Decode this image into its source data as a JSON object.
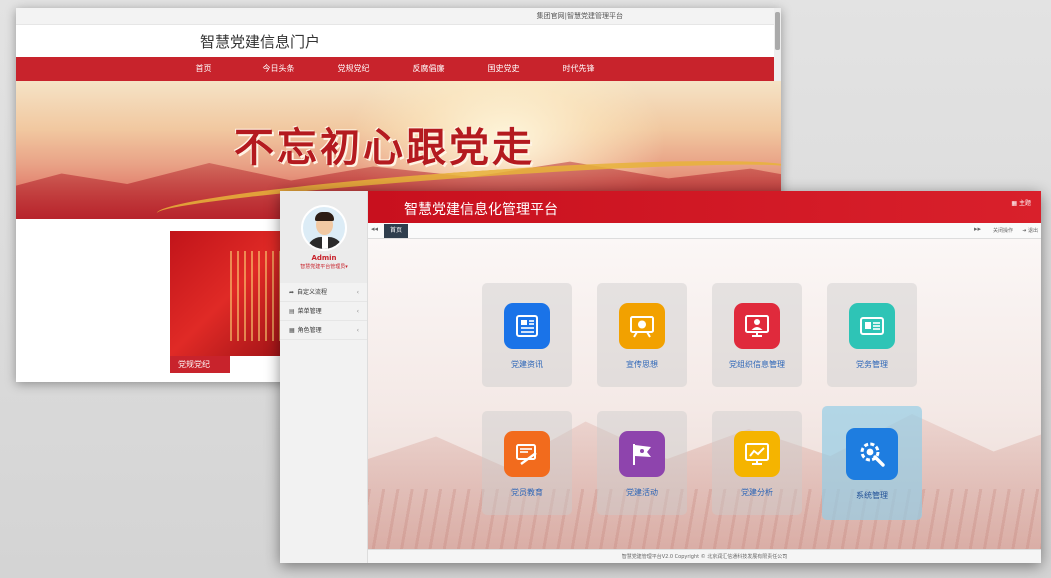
{
  "portal": {
    "topbar_link": "集团官网|智慧党建管理平台",
    "title": "智慧党建信息门户",
    "nav": [
      "首页",
      "今日头条",
      "党规党纪",
      "反腐倡廉",
      "国史党史",
      "时代先锋"
    ],
    "banner_slogan": "不忘初心跟党走",
    "news_caption": "党规党纪"
  },
  "platform": {
    "title": "智慧党建信息化管理平台",
    "topbar_home": "主题",
    "user_name": "Admin",
    "user_role": "智慧党建平台管理员",
    "menu": [
      {
        "label": "自定义流程",
        "icon": "➦"
      },
      {
        "label": "菜单管理",
        "icon": "▤"
      },
      {
        "label": "角色管理",
        "icon": "▦"
      }
    ],
    "tabs": {
      "home": "首页",
      "close_ops": "关闭操作",
      "logout": "退出"
    },
    "tiles": [
      {
        "label": "党建资讯",
        "color": "#1a73e8"
      },
      {
        "label": "宣传思想",
        "color": "#f2a100"
      },
      {
        "label": "党组织信息管理",
        "color": "#e02a3c"
      },
      {
        "label": "党务管理",
        "color": "#2ec4b6"
      },
      {
        "label": "党员教育",
        "color": "#f26b1d"
      },
      {
        "label": "党建活动",
        "color": "#8e44ad"
      },
      {
        "label": "党建分析",
        "color": "#f5b400"
      },
      {
        "label": "系统管理",
        "color": "#1e7de0"
      }
    ],
    "footer": "智慧党建管理平台V2.0 Copyright © 北京润汇信通科技发展有限责任公司"
  },
  "colors": {
    "brand_red": "#c8232c",
    "accent_blue": "#2a64b7"
  }
}
